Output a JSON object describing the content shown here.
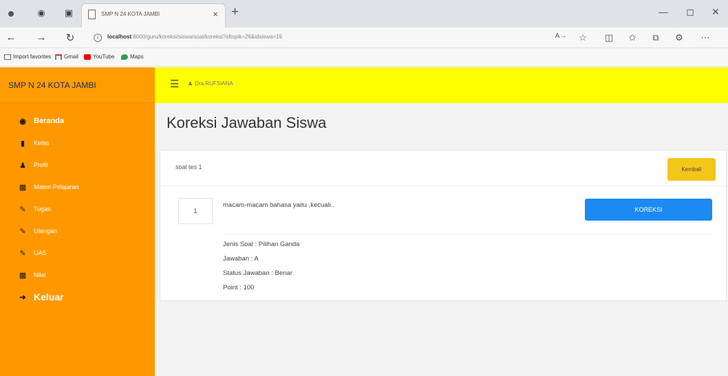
{
  "browser": {
    "tab_title": "SMP N 24 KOTA JAMBI",
    "tab_close": "×",
    "new_tab": "+",
    "url_host": "localhost",
    "url_path": ":8000/guru/koreksi/siswa/soal/koreksi?idtopik=26&idsiswa=19",
    "favorites": [
      {
        "label": "Import favorites"
      },
      {
        "label": "Gmail"
      },
      {
        "label": "YouTube"
      },
      {
        "label": "Maps"
      }
    ]
  },
  "sidebar": {
    "brand": "SMP N 24 KOTA JAMBI",
    "items": [
      {
        "label": "Beranda",
        "icon": "dashboard-icon"
      },
      {
        "label": "Kelas",
        "icon": "bookmark-icon"
      },
      {
        "label": "Profil",
        "icon": "user-icon"
      },
      {
        "label": "Materi Pelajaran",
        "icon": "file-icon"
      },
      {
        "label": "Tugas",
        "icon": "edit-icon"
      },
      {
        "label": "Ulangan",
        "icon": "edit-icon"
      },
      {
        "label": "UAS",
        "icon": "edit-icon"
      },
      {
        "label": "Nilai",
        "icon": "file-icon"
      },
      {
        "label": "Keluar",
        "icon": "sign-out-icon"
      }
    ]
  },
  "topbar": {
    "user_name": "Dra.RUFSIANA"
  },
  "main": {
    "title": "Koreksi Jawaban Siswa",
    "soal_label": "soal tes 1",
    "back_button": "Kembali",
    "question": {
      "number": "1",
      "text": "macam-macam bahasa yaitu ,kecuali..",
      "correct_button": "KOREKSI",
      "jenis": "Jenis Soal : Pilihan Ganda",
      "jawaban": "Jawaban : A",
      "status": "Status Jawaban : Benar",
      "point": "Point : 100"
    }
  },
  "colors": {
    "sidebar": "#ff9800",
    "topbar": "#ffff00",
    "primary": "#1c8af2",
    "warning": "#f5c61a"
  }
}
